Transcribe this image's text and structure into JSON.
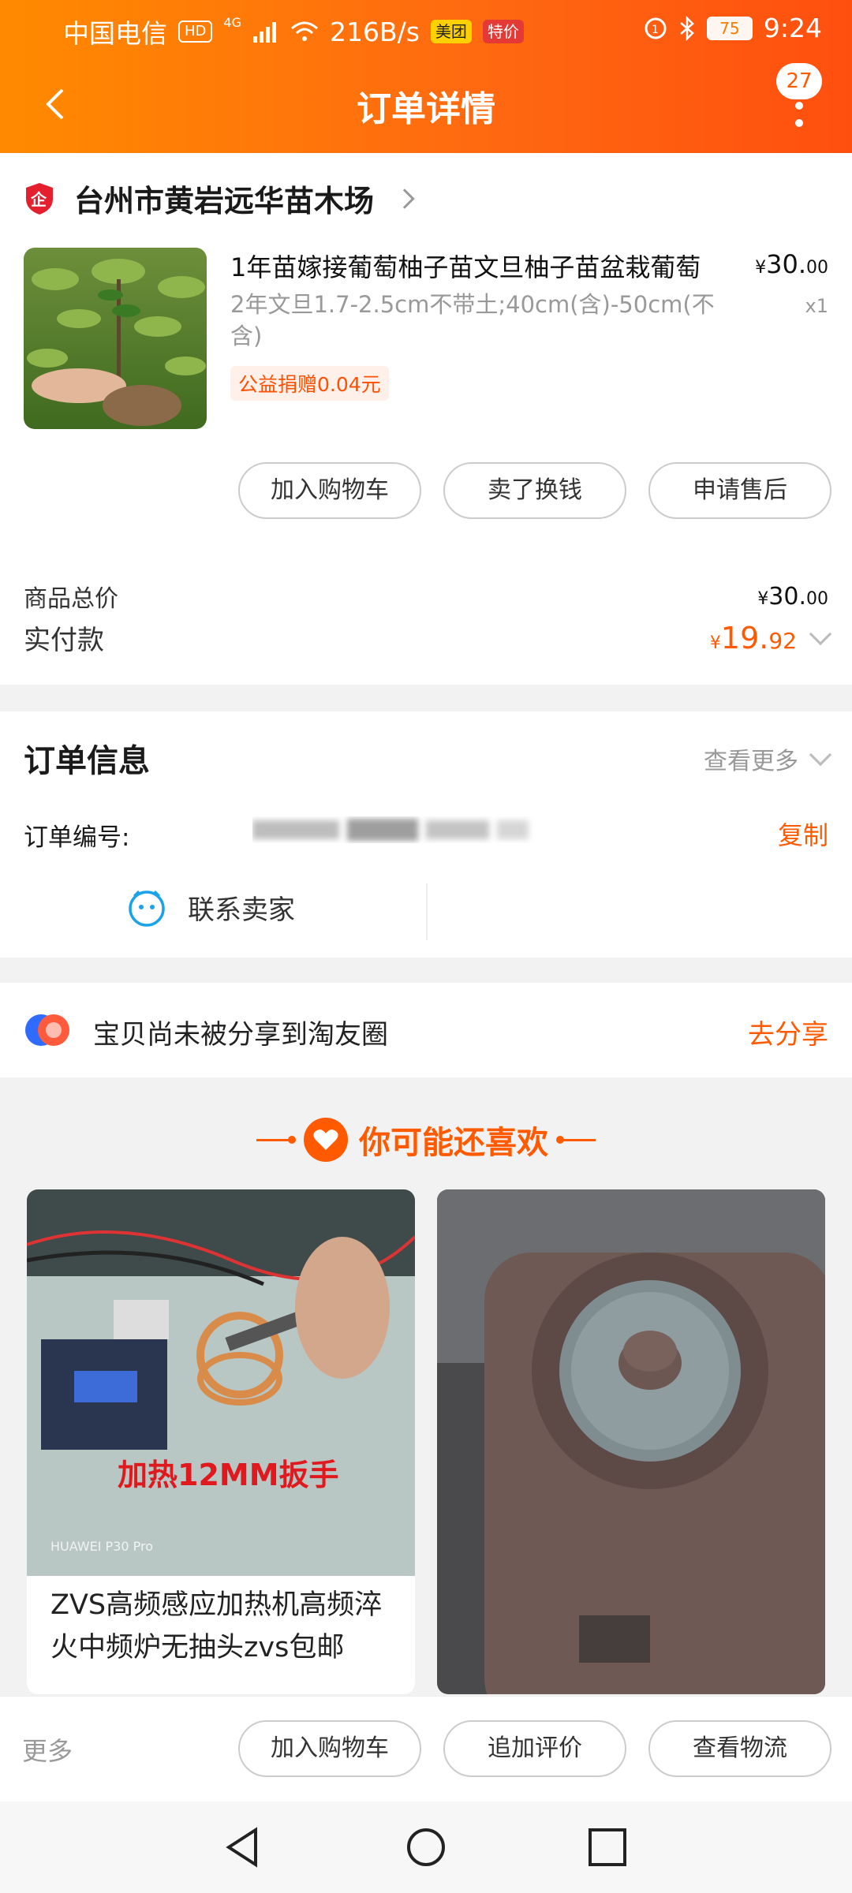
{
  "status_bar": {
    "carrier": "中国电信",
    "hd": "HD",
    "network": "4G",
    "speed": "216B/s",
    "badge_meituan": "美团",
    "badge_tejia": "特价",
    "battery": "75",
    "time": "9:24"
  },
  "nav": {
    "title": "订单详情",
    "badge_count": "27"
  },
  "shop": {
    "name": "台州市黄岩远华苗木场"
  },
  "product": {
    "title": "1年苗嫁接葡萄柚子苗文旦柚子苗盆栽葡萄",
    "spec": "2年文旦1.7-2.5cm不带土;40cm(含)-50cm(不含)",
    "donation": "公益捐赠0.04元",
    "price_symbol": "¥",
    "price_int": "30.",
    "price_dec": "00",
    "qty": "x1"
  },
  "actions": {
    "add_cart": "加入购物车",
    "sell": "卖了换钱",
    "after_sale": "申请售后"
  },
  "totals": {
    "goods_total_label": "商品总价",
    "goods_total_symbol": "¥",
    "goods_total_int": "30.",
    "goods_total_dec": "00",
    "paid_label": "实付款",
    "paid_symbol": "¥",
    "paid_int": "19.",
    "paid_dec": "92"
  },
  "order_info": {
    "title": "订单信息",
    "see_more": "查看更多",
    "order_no_label": "订单编号:",
    "copy": "复制",
    "contact_seller": "联系卖家"
  },
  "share": {
    "text": "宝贝尚未被分享到淘友圈",
    "action": "去分享"
  },
  "recommend": {
    "title": "你可能还喜欢",
    "items": [
      {
        "title": "ZVS高频感应加热机高频淬火中频炉无抽头zvs包邮",
        "overlay": "加热12MM扳手",
        "watermark": "HUAWEI P30 Pro"
      }
    ]
  },
  "bottom_bar": {
    "more": "更多",
    "add_cart": "加入购物车",
    "add_review": "追加评价",
    "logistics": "查看物流"
  },
  "colors": {
    "accent": "#ff5a00",
    "header_start": "#ff8a00",
    "header_end": "#ff4f0f"
  }
}
